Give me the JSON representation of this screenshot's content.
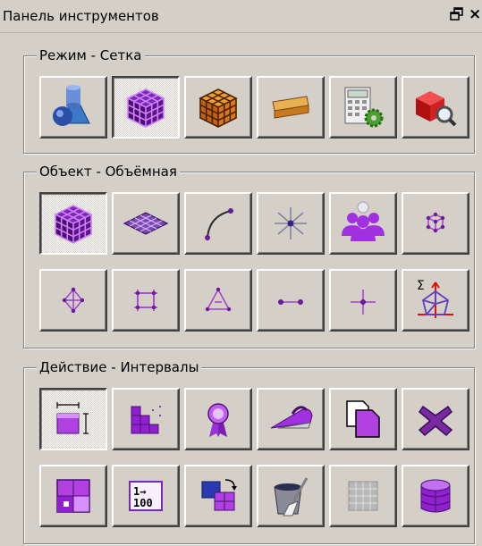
{
  "window": {
    "title": "Панель инструментов",
    "float_icon": "float-window-icon",
    "close_label": "×"
  },
  "groups": [
    {
      "title": "Режим - Сетка",
      "buttons": [
        {
          "name": "geometry-mode-button",
          "icon": "geometry-shapes-icon",
          "pressed": false
        },
        {
          "name": "mesh-mode-button",
          "icon": "purple-mesh-cube-icon",
          "pressed": true
        },
        {
          "name": "mesh-generation-button",
          "icon": "orange-mesh-cube-icon",
          "pressed": false
        },
        {
          "name": "section-mode-button",
          "icon": "section-planes-icon",
          "pressed": false
        },
        {
          "name": "calculation-settings-button",
          "icon": "calculator-gear-icon",
          "pressed": false
        },
        {
          "name": "view-results-button",
          "icon": "red-cube-magnifier-icon",
          "pressed": false
        }
      ]
    },
    {
      "title": "Объект - Объёмная",
      "buttons": [
        {
          "name": "volume-object-button",
          "icon": "purple-mesh-cube-icon",
          "pressed": true
        },
        {
          "name": "surface-object-button",
          "icon": "mesh-surface-icon",
          "pressed": false
        },
        {
          "name": "curve-object-button",
          "icon": "curve-icon",
          "pressed": false
        },
        {
          "name": "vertex-object-button",
          "icon": "vertex-star-icon",
          "pressed": false
        },
        {
          "name": "group-object-button",
          "icon": "group-people-icon",
          "pressed": false
        },
        {
          "name": "volume-node-button",
          "icon": "small-cube-nodes-icon",
          "pressed": false
        },
        {
          "name": "face-node-button",
          "icon": "diamond-nodes-icon",
          "pressed": false
        },
        {
          "name": "quad-face-button",
          "icon": "square-nodes-icon",
          "pressed": false
        },
        {
          "name": "triangle-face-button",
          "icon": "triangle-nodes-icon",
          "pressed": false
        },
        {
          "name": "edge-button",
          "icon": "edge-line-icon",
          "pressed": false
        },
        {
          "name": "node-button",
          "icon": "cross-node-icon",
          "pressed": false
        },
        {
          "name": "sum-element-button",
          "icon": "sigma-element-icon",
          "pressed": false
        }
      ]
    },
    {
      "title": "Действие - Интервалы",
      "buttons": [
        {
          "name": "intervals-action-button",
          "icon": "intervals-box-icon",
          "pressed": true
        },
        {
          "name": "split-action-button",
          "icon": "split-grid-icon",
          "pressed": false
        },
        {
          "name": "award-action-button",
          "icon": "ribbon-medal-icon",
          "pressed": false
        },
        {
          "name": "smooth-action-button",
          "icon": "iron-icon",
          "pressed": false
        },
        {
          "name": "copy-action-button",
          "icon": "copy-pages-icon",
          "pressed": false
        },
        {
          "name": "delete-action-button",
          "icon": "purple-x-icon",
          "pressed": false
        },
        {
          "name": "merge-action-button",
          "icon": "merge-blocks-icon",
          "pressed": false
        },
        {
          "name": "numbering-action-button",
          "icon": "numbering-icon",
          "pressed": false
        },
        {
          "name": "swap-action-button",
          "icon": "swap-blocks-icon",
          "pressed": false
        },
        {
          "name": "clean-action-button",
          "icon": "bucket-brush-icon",
          "pressed": false
        },
        {
          "name": "grid-action-button",
          "icon": "grey-grid-icon",
          "pressed": false
        },
        {
          "name": "database-action-button",
          "icon": "database-icon",
          "pressed": false
        }
      ]
    }
  ],
  "numbering_icon_text": {
    "top": "1→",
    "bottom": "100"
  },
  "sigma_icon_text": "Σ",
  "colors": {
    "background": "#d4d0c8",
    "accent_purple": "#9b30d9",
    "mesh_purple": "#3a0a5a",
    "mesh_orange": "#e88a20",
    "highlight": "#ffffff",
    "shadow": "#404040"
  }
}
